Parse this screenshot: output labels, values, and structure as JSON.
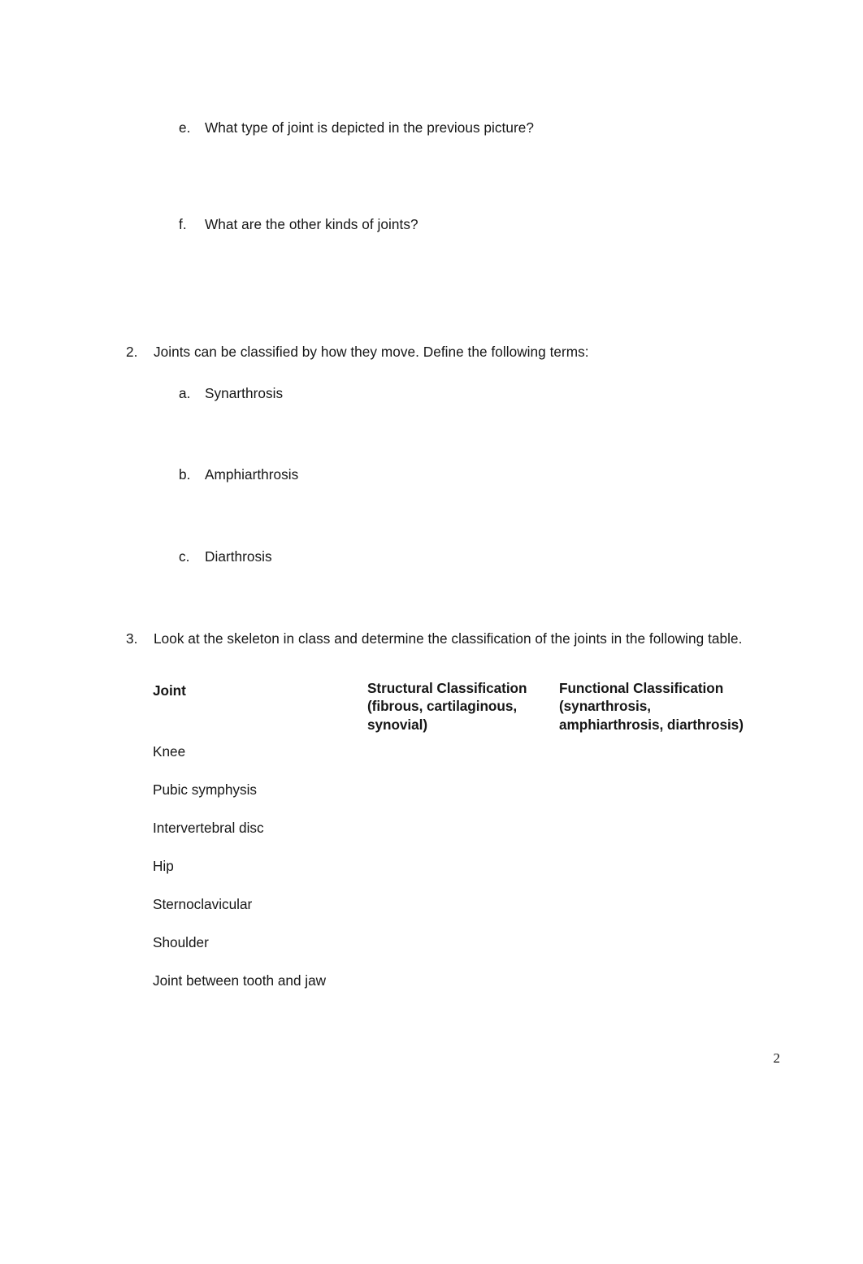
{
  "document": {
    "page_number": "2",
    "background_color": "#ffffff",
    "text_color": "#161616"
  },
  "continued_items": [
    {
      "marker": "e.",
      "text": "What type of joint is depicted in the previous picture?"
    },
    {
      "marker": "f.",
      "text": "What are the other kinds of joints?"
    }
  ],
  "question2": {
    "marker": "2.",
    "text": "Joints can be classified by how they move. Define the following terms:",
    "subitems": [
      {
        "marker": "a.",
        "text": "Synarthrosis"
      },
      {
        "marker": "b.",
        "text": "Amphiarthrosis"
      },
      {
        "marker": "c.",
        "text": "Diarthrosis"
      }
    ]
  },
  "question3": {
    "marker": "3.",
    "text": "Look at the skeleton in class and determine the classification of the joints in the following table.",
    "table": {
      "headers": {
        "joint": "Joint",
        "structural": "Structural Classification (fibrous, cartilaginous, synovial)",
        "functional": "Functional Classification (synarthrosis, amphiarthrosis, diarthrosis)"
      },
      "rows": [
        {
          "joint": "Knee",
          "structural": "",
          "functional": ""
        },
        {
          "joint": "Pubic symphysis",
          "structural": "",
          "functional": ""
        },
        {
          "joint": "Intervertebral disc",
          "structural": "",
          "functional": ""
        },
        {
          "joint": "Hip",
          "structural": "",
          "functional": ""
        },
        {
          "joint": "Sternoclavicular",
          "structural": "",
          "functional": ""
        },
        {
          "joint": "Shoulder",
          "structural": "",
          "functional": ""
        },
        {
          "joint": "Joint between tooth and jaw",
          "structural": "",
          "functional": ""
        }
      ]
    }
  }
}
